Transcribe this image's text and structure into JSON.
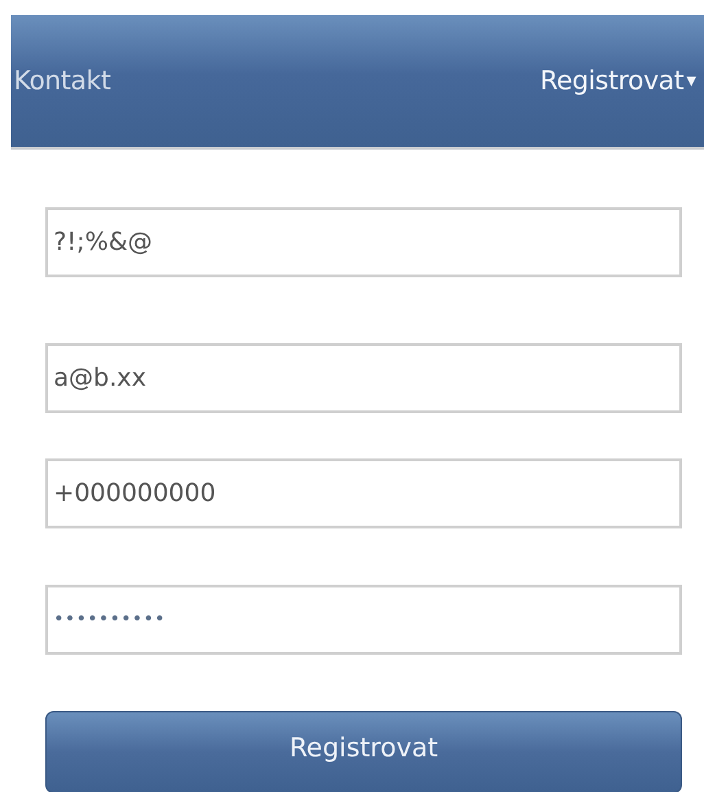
{
  "navbar": {
    "items": [
      {
        "label": "Kontakt",
        "kind": "link"
      },
      {
        "label": "Registrovat",
        "kind": "dropdown",
        "caret": "▾"
      }
    ]
  },
  "form": {
    "fields": [
      {
        "kind": "text",
        "value": "?!;%&@"
      },
      {
        "kind": "email",
        "value": "a@b.xx"
      },
      {
        "kind": "phone",
        "value": "+000000000"
      },
      {
        "kind": "password",
        "value": "••••••••••"
      }
    ],
    "submit": {
      "label": "Registrovat"
    }
  }
}
